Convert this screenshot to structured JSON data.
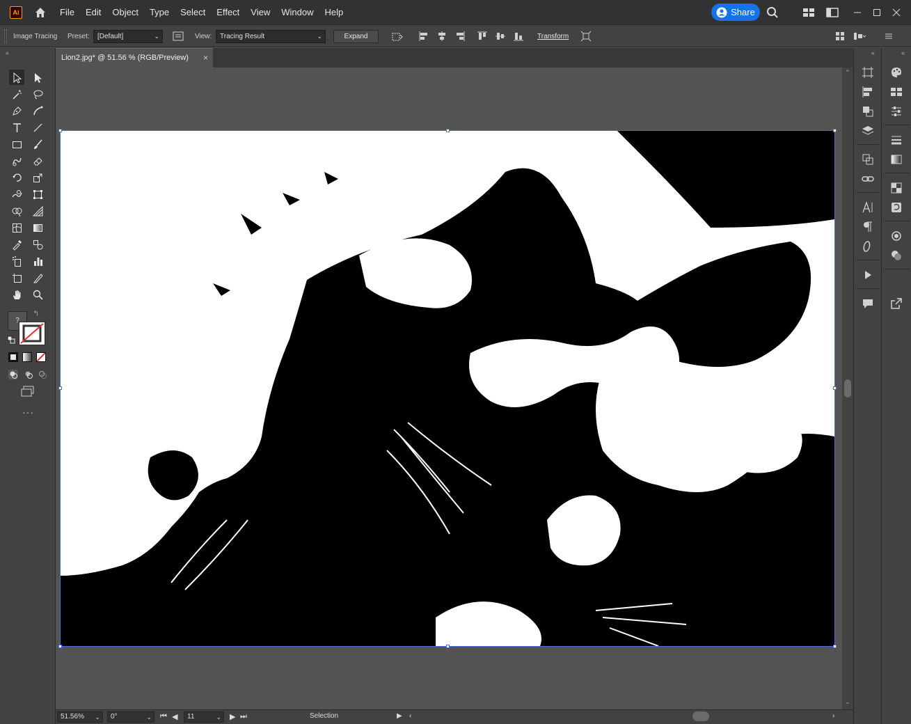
{
  "app": {
    "logo": "Ai"
  },
  "menubar": {
    "items": [
      "File",
      "Edit",
      "Object",
      "Type",
      "Select",
      "Effect",
      "View",
      "Window",
      "Help"
    ],
    "share_label": "Share"
  },
  "controlbar": {
    "panel_label": "Image Tracing",
    "preset_label": "Preset:",
    "preset_value": "[Default]",
    "view_label": "View:",
    "view_value": "Tracing Result",
    "expand_label": "Expand",
    "transform_label": "Transform"
  },
  "document": {
    "tab_title": "Lion2.jpg* @ 51.56 % (RGB/Preview)",
    "close_glyph": "×"
  },
  "statusbar": {
    "zoom": "51.56%",
    "rotation": "0°",
    "artboard": "11",
    "tool": "Selection"
  },
  "colors": {
    "accent": "#1473e6",
    "selection": "#4a6bdc"
  }
}
